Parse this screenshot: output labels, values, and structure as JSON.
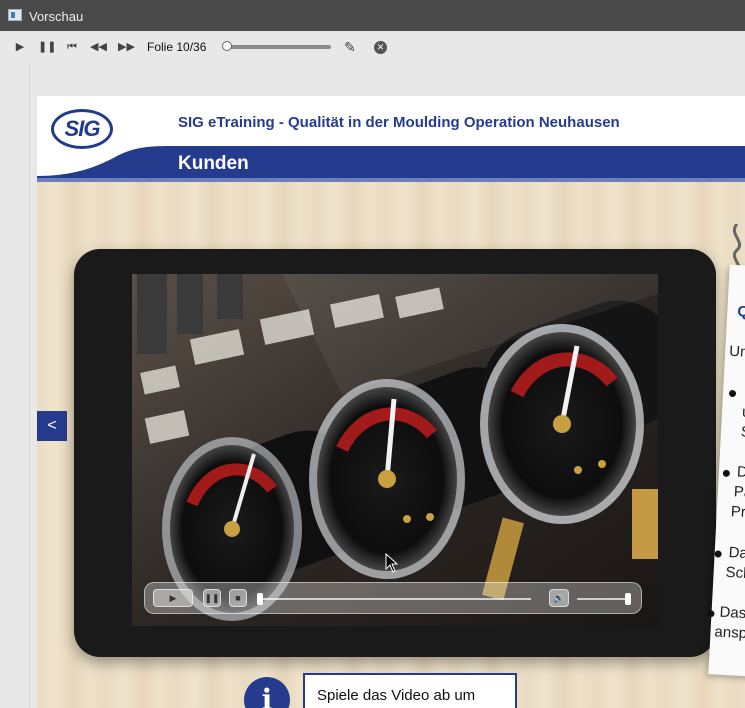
{
  "window": {
    "title": "Vorschau"
  },
  "player": {
    "slide_counter": "Folie 10/36",
    "progress": 0.0
  },
  "slide": {
    "course_title": "SIG eTraining - Qualität in der Moulding Operation Neuhausen",
    "section_title": "Kunden",
    "logo_text": "SIG",
    "prev_label": "<",
    "notepad": {
      "heading": "Qu",
      "intro": "Un",
      "items": [
        {
          "lines": [
            "I",
            "u",
            "S"
          ]
        },
        {
          "lines": [
            "Da",
            "Pa",
            "Pro"
          ]
        },
        {
          "lines": [
            "Das",
            "Sch"
          ]
        },
        {
          "lines": [
            "Dass",
            "ansp"
          ]
        }
      ]
    },
    "info": {
      "text": "Spiele das Video ab um"
    }
  },
  "colors": {
    "brand": "#253c8e",
    "titlebar": "#4a4a4a"
  }
}
